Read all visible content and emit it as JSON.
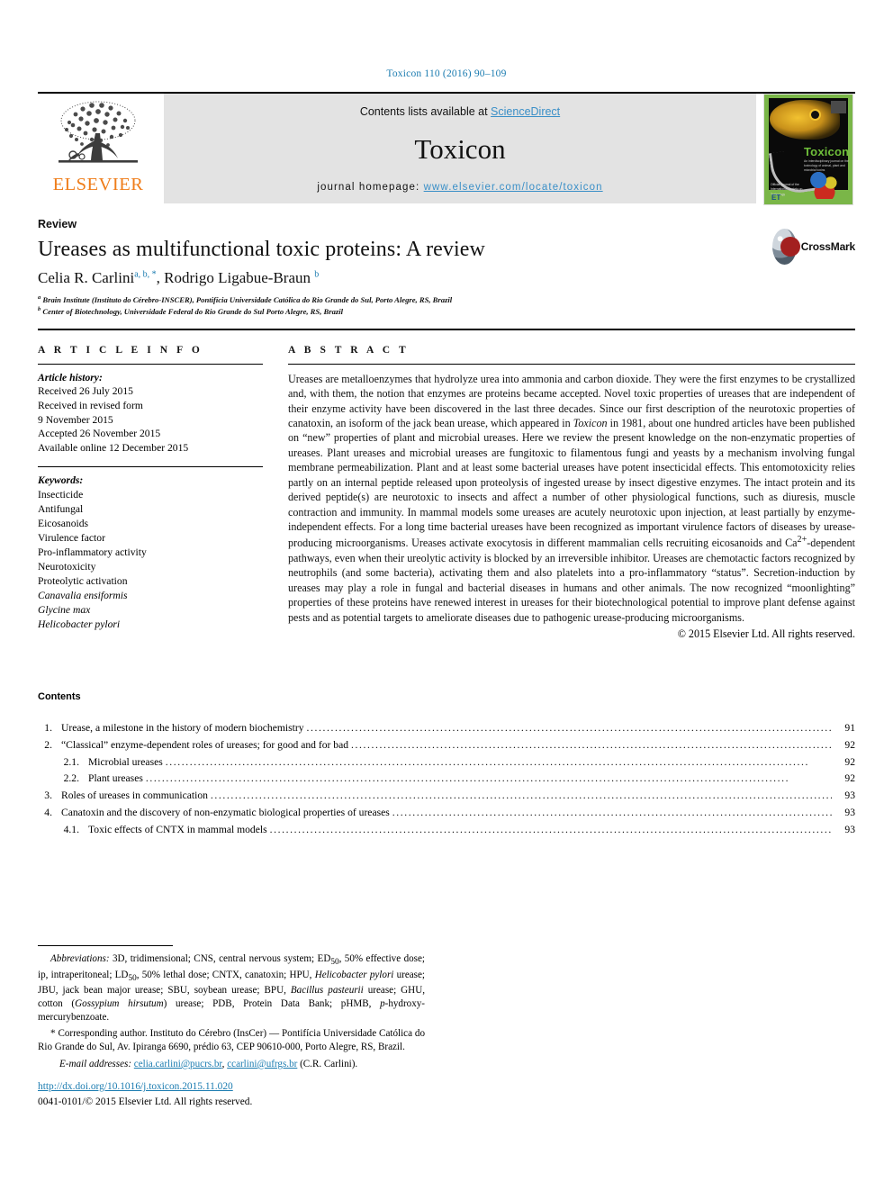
{
  "running_head": "Toxicon 110 (2016) 90–109",
  "masthead": {
    "publisher": "ELSEVIER",
    "contents_prefix": "Contents lists available at ",
    "contents_link": "ScienceDirect",
    "journal_title": "Toxicon",
    "homepage_prefix": "journal homepage: ",
    "homepage_url": "www.elsevier.com/locate/toxicon",
    "cover": {
      "title": "Toxicon",
      "subtitle": "An interdisciplinary journal on the toxinology of animal, plant and microbial toxins",
      "caption": "Official Journal of the International Society on Toxinology",
      "imprint": "ET"
    }
  },
  "article": {
    "type": "Review",
    "title": "Ureases as multifunctional toxic proteins: A review",
    "authors": "Celia R. Carlini, Rodrigo Ligabue-Braun",
    "author1": "Celia R. Carlini",
    "author1_sups": "a, b, *",
    "author2": "Rodrigo Ligabue-Braun",
    "author2_sups": "b",
    "affiliation_a": "Brain Institute (Instituto do Cérebro-INSCER), Pontifícia Universidade Católica do Rio Grande do Sul, Porto Alegre, RS, Brazil",
    "affiliation_b": "Center of Biotechnology, Universidade Federal do Rio Grande do Sul Porto Alegre, RS, Brazil",
    "crossmark_label": "CrossMark"
  },
  "article_info": {
    "heading": "A R T I C L E   I N F O",
    "history_label": "Article history:",
    "history": [
      "Received 26 July 2015",
      "Received in revised form",
      "9 November 2015",
      "Accepted 26 November 2015",
      "Available online 12 December 2015"
    ],
    "keywords_label": "Keywords:",
    "keywords": [
      {
        "text": "Insecticide",
        "italic": false
      },
      {
        "text": "Antifungal",
        "italic": false
      },
      {
        "text": "Eicosanoids",
        "italic": false
      },
      {
        "text": "Virulence factor",
        "italic": false
      },
      {
        "text": "Pro-inflammatory activity",
        "italic": false
      },
      {
        "text": "Neurotoxicity",
        "italic": false
      },
      {
        "text": "Proteolytic activation",
        "italic": false
      },
      {
        "text": "Canavalia ensiformis",
        "italic": true
      },
      {
        "text": "Glycine max",
        "italic": true
      },
      {
        "text": "Helicobacter pylori",
        "italic": true
      }
    ]
  },
  "abstract": {
    "heading": "A B S T R A C T",
    "text": "Ureases are metalloenzymes that hydrolyze urea into ammonia and carbon dioxide. They were the first enzymes to be crystallized and, with them, the notion that enzymes are proteins became accepted. Novel toxic properties of ureases that are independent of their enzyme activity have been discovered in the last three decades. Since our first description of the neurotoxic properties of canatoxin, an isoform of the jack bean urease, which appeared in Toxicon in 1981, about one hundred articles have been published on “new” properties of plant and microbial ureases. Here we review the present knowledge on the non-enzymatic properties of ureases. Plant ureases and microbial ureases are fungitoxic to filamentous fungi and yeasts by a mechanism involving fungal membrane permeabilization. Plant and at least some bacterial ureases have potent insecticidal effects. This entomotoxicity relies partly on an internal peptide released upon proteolysis of ingested urease by insect digestive enzymes. The intact protein and its derived peptide(s) are neurotoxic to insects and affect a number of other physiological functions, such as diuresis, muscle contraction and immunity. In mammal models some ureases are acutely neurotoxic upon injection, at least partially by enzyme-independent effects. For a long time bacterial ureases have been recognized as important virulence factors of diseases by urease-producing microorganisms. Ureases activate exocytosis in different mammalian cells recruiting eicosanoids and Ca2+-dependent pathways, even when their ureolytic activity is blocked by an irreversible inhibitor. Ureases are chemotactic factors recognized by neutrophils (and some bacteria), activating them and also platelets into a pro-inflammatory “status”. Secretion-induction by ureases may play a role in fungal and bacterial diseases in humans and other animals. The now recognized “moonlighting” properties of these proteins have renewed interest in ureases for their biotechnological potential to improve plant defense against pests and as potential targets to ameliorate diseases due to pathogenic urease-producing microorganisms.",
    "copyright": "© 2015 Elsevier Ltd. All rights reserved."
  },
  "contents": {
    "heading": "Contents",
    "items": [
      {
        "num": "1.",
        "sub": false,
        "label": "Urease, a milestone in the history of modern biochemistry",
        "page": "91"
      },
      {
        "num": "2.",
        "sub": false,
        "label": "“Classical” enzyme-dependent roles of ureases; for good and for bad",
        "page": "92"
      },
      {
        "num": "2.1.",
        "sub": true,
        "label": "Microbial ureases",
        "page": "92"
      },
      {
        "num": "2.2.",
        "sub": true,
        "label": "Plant ureases",
        "page": "92"
      },
      {
        "num": "3.",
        "sub": false,
        "label": "Roles of ureases in communication",
        "page": "93"
      },
      {
        "num": "4.",
        "sub": false,
        "label": "Canatoxin and the discovery of non-enzymatic biological properties of ureases",
        "page": "93"
      },
      {
        "num": "4.1.",
        "sub": true,
        "label": "Toxic effects of CNTX in mammal models",
        "page": "93"
      }
    ]
  },
  "footnotes": {
    "abbreviations_label": "Abbreviations:",
    "abbreviations_text": " 3D, tridimensional; CNS, central nervous system; ED50, 50% effective dose; ip, intraperitoneal; LD50, 50% lethal dose; CNTX, canatoxin; HPU, Helicobacter pylori urease; JBU, jack bean major urease; SBU, soybean urease; BPU, Bacillus pasteurii urease; GHU, cotton (Gossypium hirsutum) urease; PDB, Protein Data Bank; pHMB, p-hydroxy-mercurybenzoate.",
    "corresponding_marker": "*",
    "corresponding_text": " Corresponding author. Instituto do Cérebro (InsCer) — Pontifícia Universidade Católica do Rio Grande do Sul, Av. Ipiranga 6690, prédio 63, CEP 90610-000, Porto Alegre, RS, Brazil.",
    "email_label": "E-mail addresses:",
    "email1": "celia.carlini@pucrs.br",
    "email2": "ccarlini@ufrgs.br",
    "email_suffix": " (C.R. Carlini)."
  },
  "footer": {
    "doi": "http://dx.doi.org/10.1016/j.toxicon.2015.11.020",
    "issn_line": "0041-0101/© 2015 Elsevier Ltd. All rights reserved."
  },
  "colors": {
    "link_blue": "#1a7bb0",
    "elsevier_orange": "#ef7d1a",
    "band_gray": "#e3e3e3"
  }
}
